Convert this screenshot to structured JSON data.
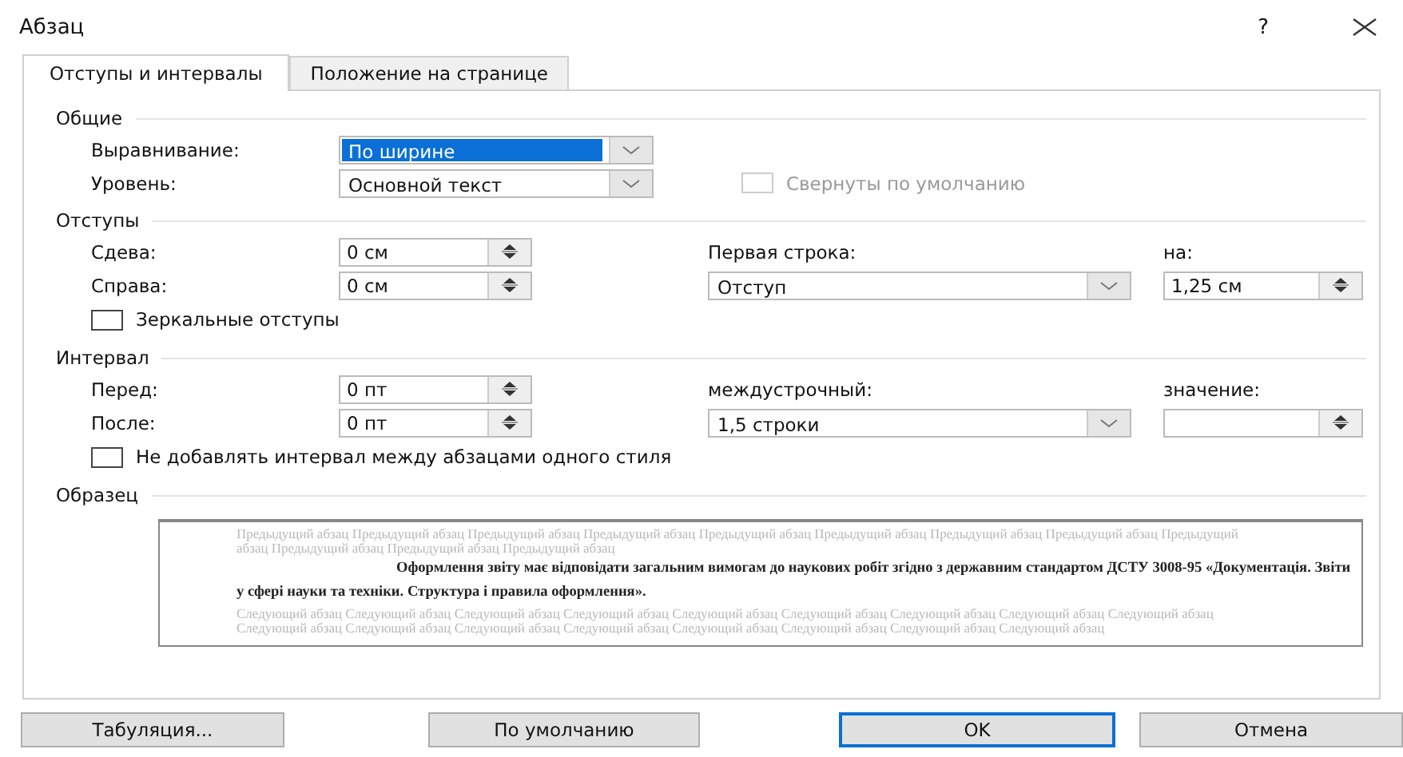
{
  "window": {
    "title": "Абзац",
    "help": "?"
  },
  "tabs": [
    {
      "label": "Отступы и интервалы",
      "selected": true
    },
    {
      "label": "Положение на странице",
      "selected": false
    }
  ],
  "general": {
    "title": "Общие",
    "alignment": {
      "label": "Выравнивание:",
      "value": "По ширине",
      "highlighted": true
    },
    "level": {
      "label": "Уровень:",
      "value": "Основной текст",
      "highlighted": false
    },
    "collapsed": {
      "label": "Свернуты по умолчанию",
      "checked": false,
      "disabled": true
    }
  },
  "indents": {
    "title": "Отступы",
    "left": {
      "label": "Сдева:",
      "value": "0 см"
    },
    "right": {
      "label": "Справа:",
      "value": "0 см"
    },
    "first_line": {
      "label": "Первая строка:",
      "value": "Отступ",
      "highlighted": false
    },
    "by": {
      "label": "на:",
      "value": "1,25 см"
    },
    "mirror": {
      "label": "Зеркальные отступы",
      "checked": false,
      "disabled": false
    }
  },
  "spacing": {
    "title": "Интервал",
    "before": {
      "label": "Перед:",
      "value": "0 пт"
    },
    "after": {
      "label": "После:",
      "value": "0 пт"
    },
    "line_spacing": {
      "label": "междустрочный:",
      "value": "1,5 строки",
      "highlighted": false
    },
    "at": {
      "label": "значение:"
    },
    "dont_add": {
      "label": "Не добавлять интервал между абзацами одного стиля",
      "checked": false,
      "disabled": false
    }
  },
  "preview": {
    "title": "Образец",
    "previous": "Предыдущий абзац Предыдущий абзац Предыдущий абзац Предыдущий абзац Предыдущий абзац Предыдущий абзац Предыдущий абзац Предыдущий абзац Предыдущий абзац Предыдущий абзац Предыдущий абзац Предыдущий абзац",
    "current": "Оформлення звіту має відповідати загальним вимогам до наукових робіт згідно з державним стандартом ДСТУ 3008-95 «Документація. Звіти у сфері науки та техніки. Структура і правила оформлення».",
    "next": "Следующий абзац Следующий абзац Следующий абзац Следующий абзац Следующий абзац Следующий абзац Следующий абзац Следующий абзац Следующий абзац Следующий абзац Следующий абзац Следующий абзац Следующий абзац Следующий абзац Следующий абзац Следующий абзац Следующий абзац"
  },
  "buttons": [
    {
      "label": "Табуляция...",
      "default": false
    },
    {
      "label": "По умолчанию",
      "default": false
    },
    {
      "label": "OK",
      "default": true
    },
    {
      "label": "Отмена",
      "default": false
    }
  ]
}
